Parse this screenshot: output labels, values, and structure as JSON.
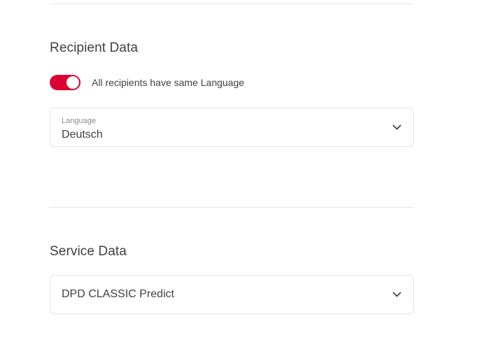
{
  "recipient": {
    "title": "Recipient Data",
    "same_language_toggle": {
      "label": "All recipients have same Language",
      "on": true,
      "color": "#dc0032"
    },
    "language_select": {
      "label": "Language",
      "value": "Deutsch",
      "icon": "chevron-down-icon"
    }
  },
  "service": {
    "title": "Service Data",
    "service_select": {
      "value": "DPD CLASSIC Predict",
      "icon": "chevron-down-icon"
    }
  }
}
